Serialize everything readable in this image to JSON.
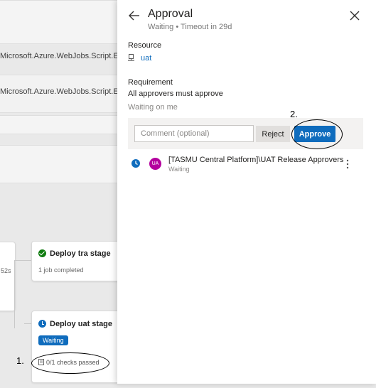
{
  "background": {
    "rows": [
      {
        "text": "Microsoft.Azure.WebJobs.Script.Exte"
      },
      {
        "text": "Microsoft.Azure.WebJobs.Script.Exte"
      }
    ],
    "partial_duration": "52s",
    "stages": [
      {
        "title": "Deploy tra stage",
        "status": "success",
        "subtitle": "1 job completed"
      },
      {
        "title": "Deploy uat stage",
        "status": "waiting",
        "badge": "Waiting",
        "checks": "0/1 checks passed"
      }
    ],
    "annotations": {
      "one": "1.",
      "two": "2."
    }
  },
  "panel": {
    "title": "Approval",
    "subtitle": "Waiting • Timeout in 29d",
    "resource_label": "Resource",
    "resource_name": "uat",
    "requirement_label": "Requirement",
    "requirement_text": "All approvers must approve",
    "waiting_on": "Waiting on me",
    "comment_placeholder": "Comment (optional)",
    "reject_label": "Reject",
    "approve_label": "Approve",
    "approver": {
      "initials": "UA",
      "name": "[TASMU Central Platform]\\UAT Release Approvers",
      "status": "Waiting"
    }
  },
  "colors": {
    "accent": "#0f6cbd",
    "success": "#107c10",
    "avatar": "#b4009e"
  }
}
